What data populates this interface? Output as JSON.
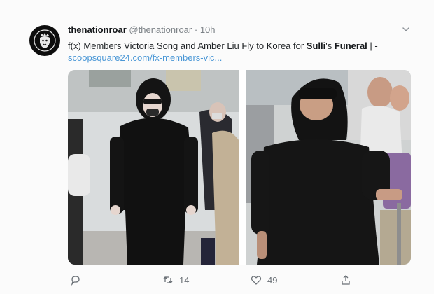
{
  "account": {
    "display_name": "thenationroar",
    "handle": "@thenationroar",
    "separator": "·",
    "time": "10h"
  },
  "tweet": {
    "text_part1": "f(x) Members Victoria Song and Amber Liu Fly to Korea for ",
    "text_bold1": "Sulli",
    "text_part2": "'s ",
    "text_bold2": "Funeral",
    "text_part3": " | -",
    "link": "scoopsquare24.com/fx-members-vic..."
  },
  "actions": {
    "reply_count": "",
    "retweet_count": "14",
    "like_count": "49"
  },
  "icons": {
    "avatar": "lion-logo-icon",
    "menu": "chevron-down-icon",
    "reply": "reply-icon",
    "retweet": "retweet-icon",
    "like": "heart-icon",
    "share": "share-icon"
  },
  "colors": {
    "link": "#4a97d6",
    "text": "#1f2326",
    "muted": "#7b8186"
  }
}
